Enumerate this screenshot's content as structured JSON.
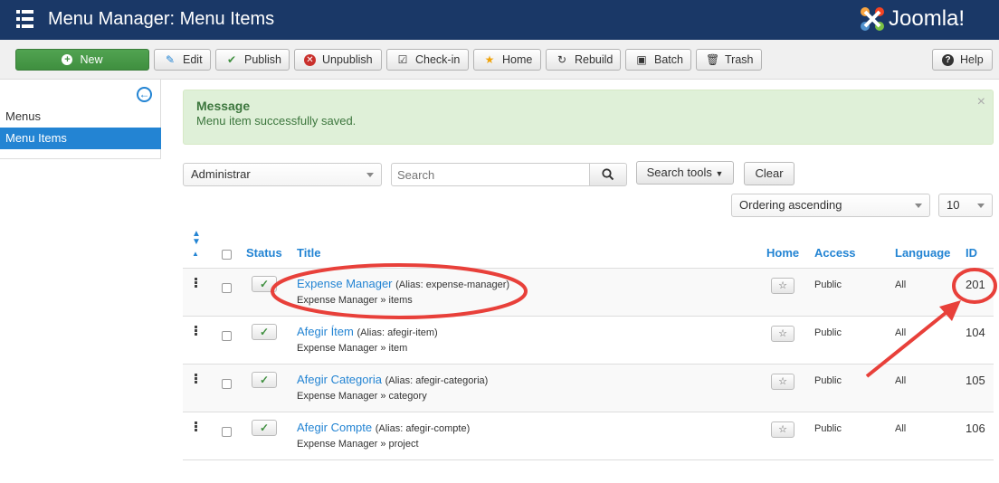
{
  "header": {
    "title": "Menu Manager: Menu Items",
    "logo_text": "Joomla!"
  },
  "toolbar": {
    "buttons": [
      {
        "label": "New",
        "icon": "plus-circle-icon"
      },
      {
        "label": "Edit",
        "icon": "edit-icon"
      },
      {
        "label": "Publish",
        "icon": "check-icon"
      },
      {
        "label": "Unpublish",
        "icon": "x-circle-icon"
      },
      {
        "label": "Check-in",
        "icon": "checkbox-icon"
      },
      {
        "label": "Home",
        "icon": "star-icon"
      },
      {
        "label": "Rebuild",
        "icon": "refresh-icon"
      },
      {
        "label": "Batch",
        "icon": "square-icon"
      },
      {
        "label": "Trash",
        "icon": "trash-icon"
      }
    ],
    "help": "Help"
  },
  "sidebar": {
    "items": [
      {
        "label": "Menus"
      },
      {
        "label": "Menu Items",
        "active": true
      }
    ]
  },
  "message": {
    "heading": "Message",
    "body": "Menu item successfully saved."
  },
  "filters": {
    "menu_select": "Administrar",
    "search_placeholder": "Search",
    "search_tools": "Search tools",
    "clear": "Clear",
    "ordering": "Ordering ascending",
    "limit": "10"
  },
  "table": {
    "headers": {
      "status": "Status",
      "title": "Title",
      "home": "Home",
      "access": "Access",
      "language": "Language",
      "id": "ID"
    },
    "rows": [
      {
        "title": "Expense Manager",
        "alias": "(Alias: expense-manager)",
        "path": "Expense Manager » items",
        "access": "Public",
        "language": "All",
        "id": "201"
      },
      {
        "title": "Afegir Ítem",
        "alias": "(Alias: afegir-item)",
        "path": "Expense Manager » item",
        "access": "Public",
        "language": "All",
        "id": "104"
      },
      {
        "title": "Afegir Categoria",
        "alias": "(Alias: afegir-categoria)",
        "path": "Expense Manager » category",
        "access": "Public",
        "language": "All",
        "id": "105"
      },
      {
        "title": "Afegir Compte",
        "alias": "(Alias: afegir-compte)",
        "path": "Expense Manager » project",
        "access": "Public",
        "language": "All",
        "id": "106"
      }
    ]
  },
  "colors": {
    "header_bg": "#1a3867",
    "accent": "#2384d3",
    "success": "#3f8f3f",
    "annotation": "#e8403a"
  }
}
